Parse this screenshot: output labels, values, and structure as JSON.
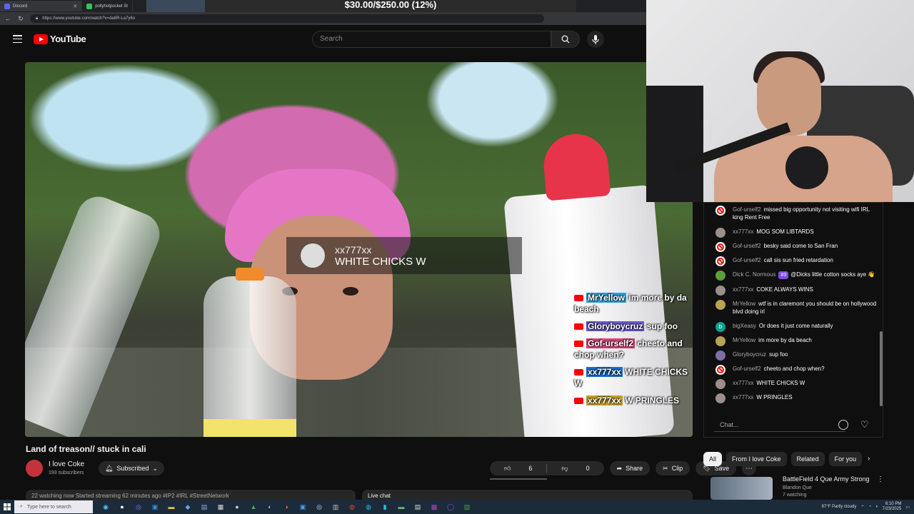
{
  "browser": {
    "tabs": [
      {
        "label": "Discord"
      },
      {
        "label": "pollyhotpocket St"
      }
    ],
    "url": "https://www.youtube.com/watch?v=da6R-La7y6o",
    "goal_text": "$30.00/$250.00 (12%)"
  },
  "header": {
    "logo_text": "YouTube",
    "search_placeholder": "Search"
  },
  "video_overlay": {
    "alert_user": "xx777xx",
    "alert_message": "WHITE CHICKS W",
    "chat": [
      {
        "name": "MrYellow",
        "name_color": "#2aa3e0",
        "text": "im more by da beach"
      },
      {
        "name": "Gloryboycruz",
        "name_color": "#6a5acd",
        "text": "sup foo"
      },
      {
        "name": "Gof-urself2",
        "name_color": "#e0407a",
        "text": "cheeto and chop when?"
      },
      {
        "name": "xx777xx",
        "name_color": "#1a6fd0",
        "text": "WHITE CHICKS W"
      },
      {
        "name": "xx777xx",
        "name_color": "#c9a227",
        "text": "W PRINGLES"
      }
    ]
  },
  "live_chat": {
    "messages": [
      {
        "avatar": "ban",
        "author": "Gof-urself2",
        "text": "missed big opportunity not visiting wifi IRL king Rent Free"
      },
      {
        "avatar": "gray",
        "author": "xx777xx",
        "text": "MOG SOM LIBTARDS"
      },
      {
        "avatar": "ban",
        "author": "Gof-urself2",
        "text": "besky said come to San Fran"
      },
      {
        "avatar": "ban",
        "author": "Gof-urself2",
        "text": "call sis sun fried retardation"
      },
      {
        "avatar": "green",
        "author": "Dick C. Normous",
        "badge": "#3",
        "text": "@Dicks little cotton socks aye 👋"
      },
      {
        "avatar": "gray",
        "author": "xx777xx",
        "text": "COKE ALWAYS WINS"
      },
      {
        "avatar": "yellow",
        "author": "MrYellow",
        "text": "wtf is in claremont you should be on hollywood blvd doing irl"
      },
      {
        "avatar": "teal",
        "avatar_letter": "b",
        "author": "bigXeasy",
        "text": "Or does it just come naturally"
      },
      {
        "avatar": "yellow",
        "author": "MrYellow",
        "text": "im more by da beach"
      },
      {
        "avatar": "purple",
        "author": "Gloryboycruz",
        "text": "sup foo"
      },
      {
        "avatar": "ban",
        "author": "Gof-urself2",
        "text": "cheeto and chop when?"
      },
      {
        "avatar": "gray",
        "author": "xx777xx",
        "text": "WHITE CHICKS W"
      },
      {
        "avatar": "gray",
        "author": "xx777xx",
        "text": "W PRINGLES"
      }
    ],
    "input_placeholder": "Chat..."
  },
  "video_info": {
    "title": "Land of treason// stuck in cali",
    "channel": "I love Coke",
    "subscribers": "193 subscribers",
    "subscribe_label": "Subscribed",
    "likes": "6",
    "dislikes": "0",
    "share_label": "Share",
    "clip_label": "Clip",
    "save_label": "Save",
    "description_preview": "22 watching now  Started streaming 62 minutes ago  #IP2 #IRL #StreetNetwork",
    "live_chat_label": "Live chat"
  },
  "sidebar": {
    "chips": [
      "All",
      "From I love Coke",
      "Related",
      "For you"
    ],
    "recommendation": {
      "title": "BattleField 4 Que Army Strong",
      "channel": "Blandon Que",
      "meta": "7 watching"
    }
  },
  "taskbar": {
    "search_placeholder": "Type here to search",
    "weather": "87°F  Partly cloudy",
    "time": "6:10 PM",
    "date": "7/23/2025"
  }
}
